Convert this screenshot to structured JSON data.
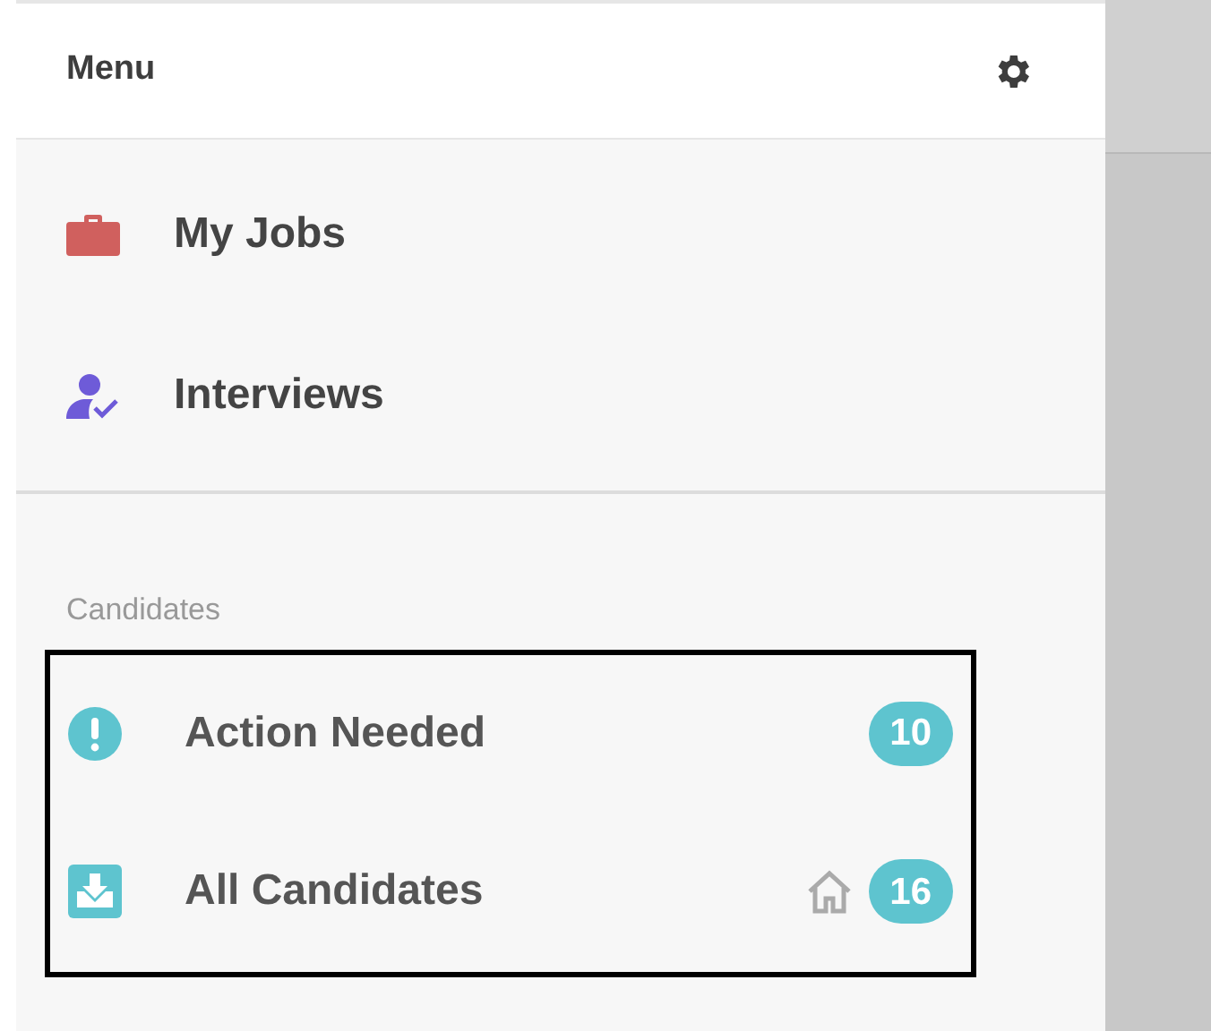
{
  "menu": {
    "title": "Menu"
  },
  "main_items": [
    {
      "kind": "jobs",
      "label": "My Jobs"
    },
    {
      "kind": "interviews",
      "label": "Interviews"
    }
  ],
  "candidates": {
    "heading": "Candidates",
    "outlined": true,
    "items": [
      {
        "kind": "action",
        "label": "Action Needed",
        "home": false,
        "count": "10"
      },
      {
        "kind": "all",
        "label": "All Candidates",
        "home": true,
        "count": "16"
      }
    ]
  }
}
